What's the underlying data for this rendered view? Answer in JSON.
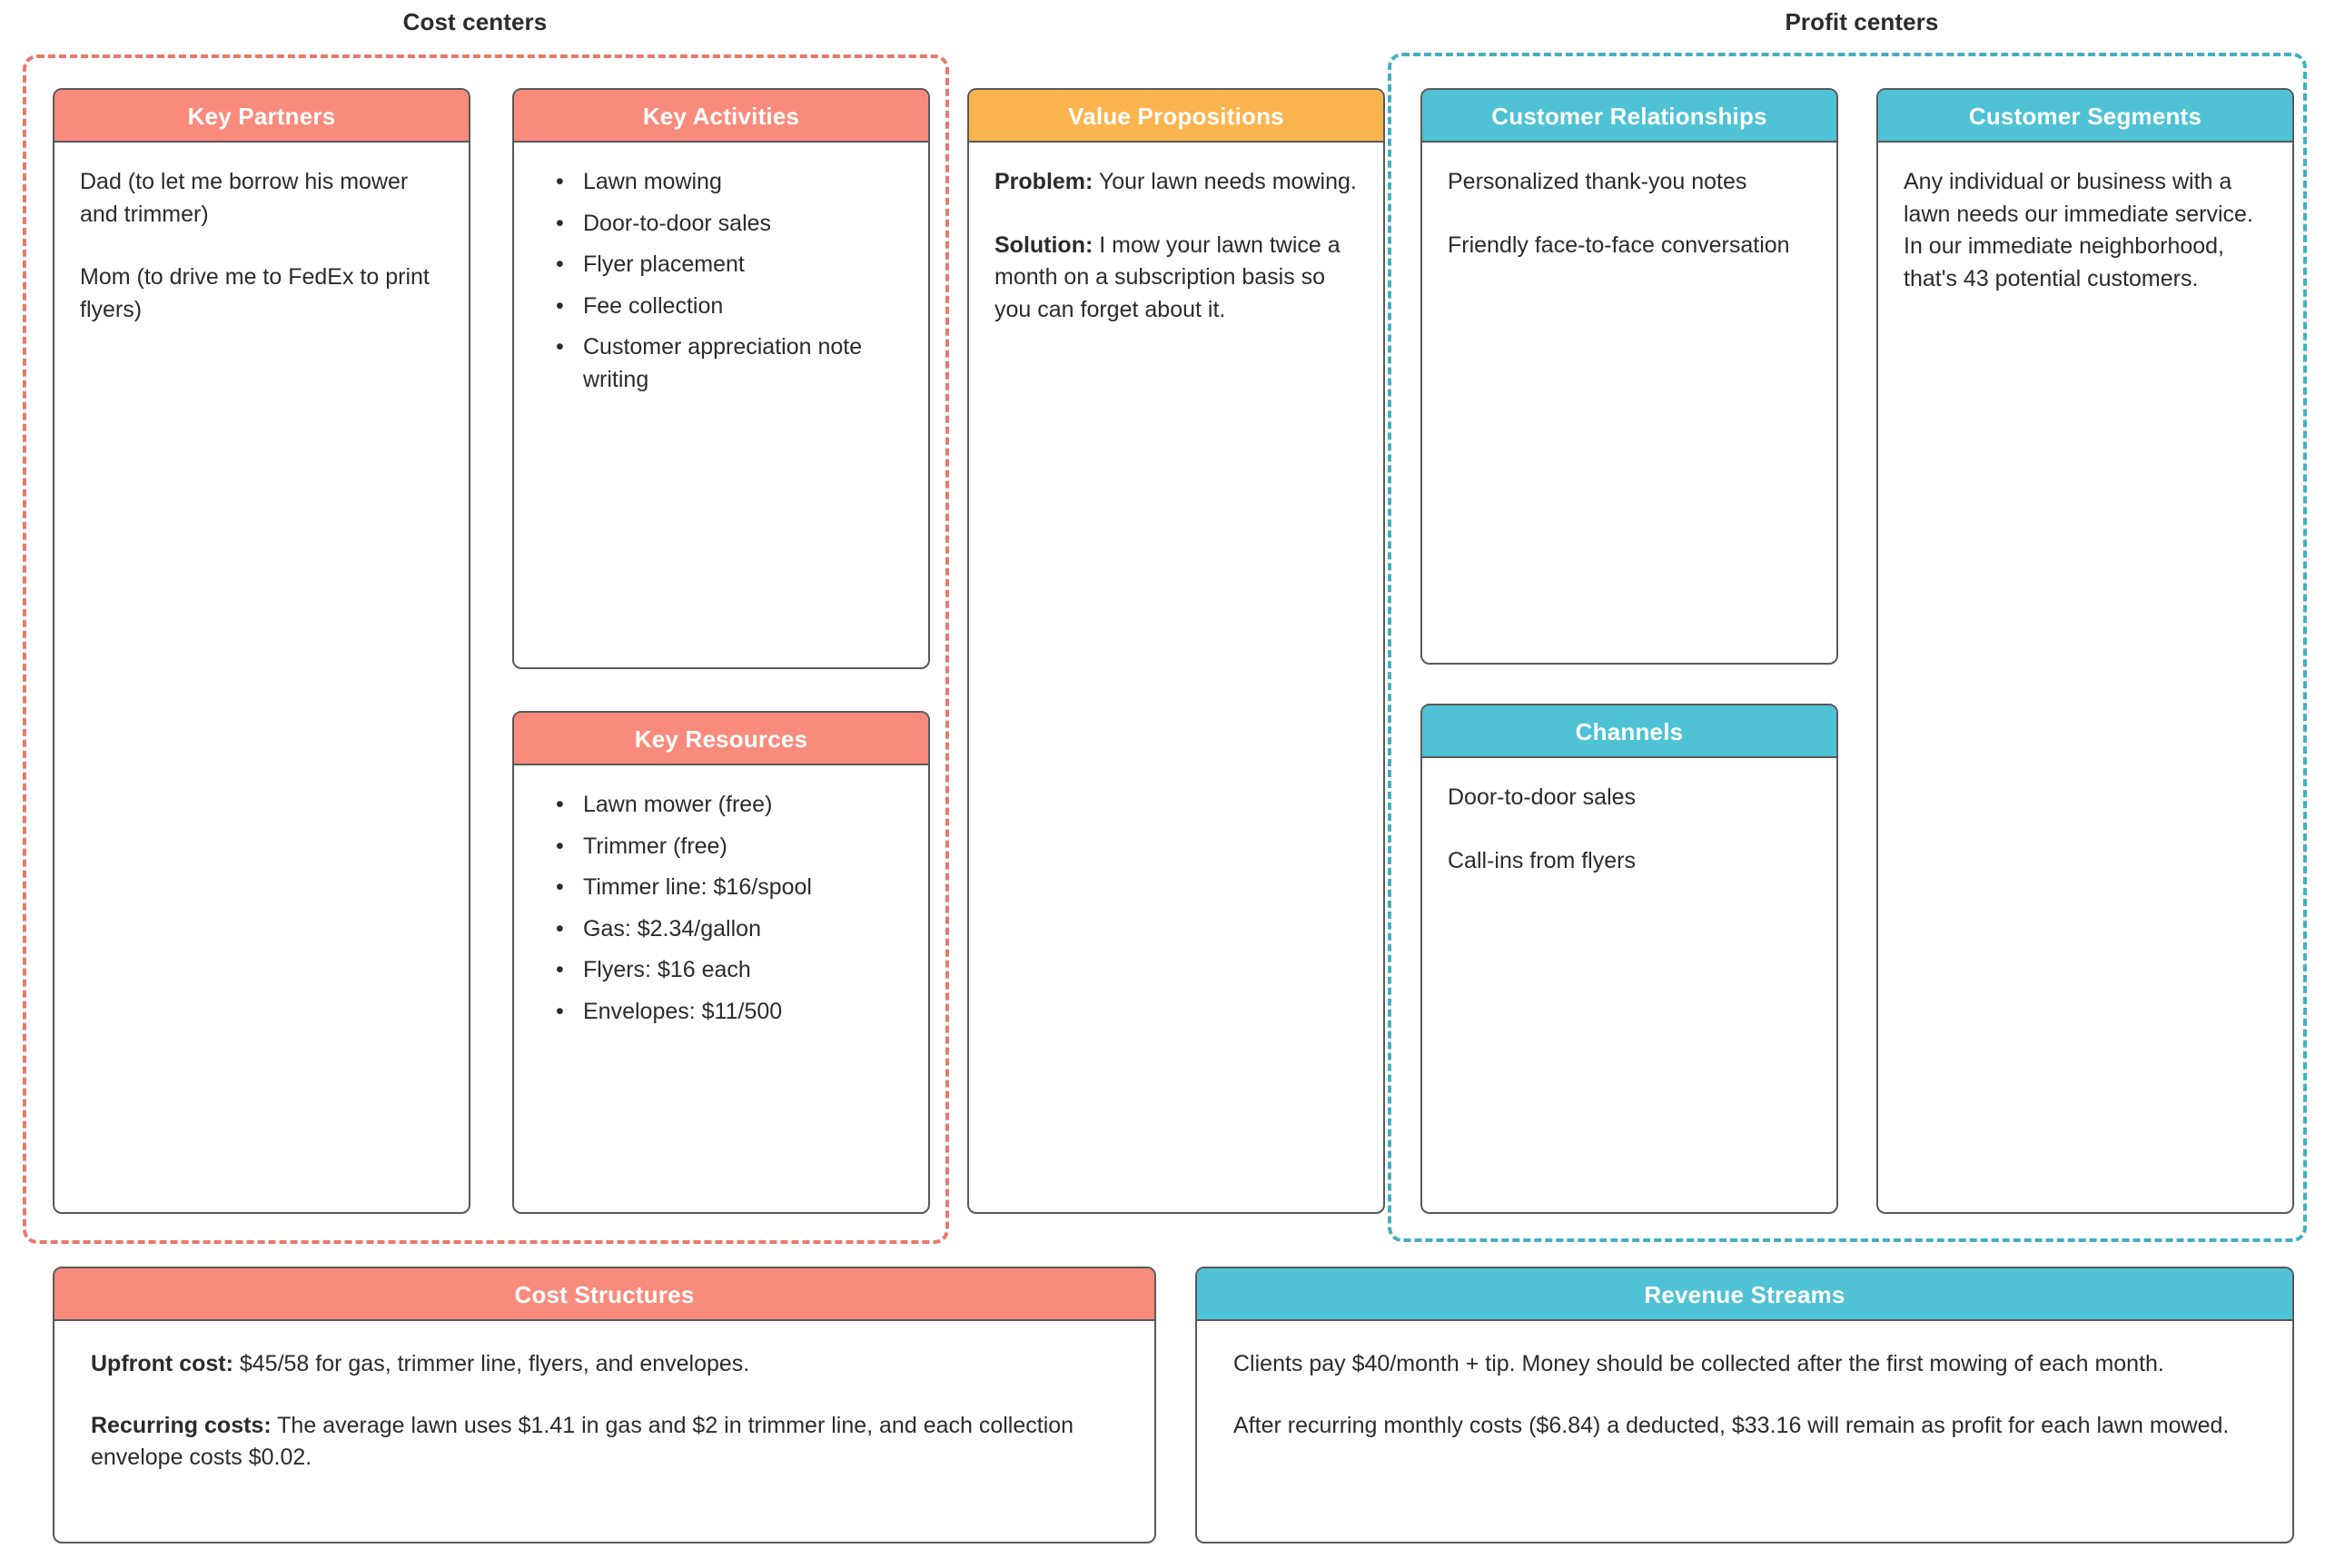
{
  "groups": {
    "cost_centers_label": "Cost centers",
    "profit_centers_label": "Profit centers",
    "cost_border_color": "#E8796B",
    "profit_border_color": "#44AFC1"
  },
  "colors": {
    "red_header": "#F98B7C",
    "teal_header": "#4FC2D5",
    "orange_header": "#FCB44F",
    "panel_border": "#58595B",
    "text": "#2B2B2B"
  },
  "panels": {
    "key_partners": {
      "title": "Key Partners",
      "paragraphs": [
        "Dad (to let me borrow his mower and trimmer)",
        "Mom (to drive me to FedEx to print flyers)"
      ]
    },
    "key_activities": {
      "title": "Key Activities",
      "bullets": [
        "Lawn mowing",
        "Door-to-door sales",
        "Flyer placement",
        "Fee collection",
        "Customer appreciation note writing"
      ]
    },
    "key_resources": {
      "title": "Key Resources",
      "bullets": [
        "Lawn mower (free)",
        "Trimmer (free)",
        "Timmer line: $16/spool",
        "Gas: $2.34/gallon",
        "Flyers: $16 each",
        "Envelopes: $11/500"
      ]
    },
    "value_propositions": {
      "title": "Value Propositions",
      "problem_label": "Problem:",
      "problem_text": " Your lawn needs mowing.",
      "solution_label": "Solution:",
      "solution_text": " I mow your lawn twice a month on a subscription basis so you can forget about it."
    },
    "customer_relationships": {
      "title": "Customer Relationships",
      "paragraphs": [
        "Personalized thank-you notes",
        "Friendly face-to-face conversation"
      ]
    },
    "channels": {
      "title": "Channels",
      "paragraphs": [
        "Door-to-door sales",
        "Call-ins from flyers"
      ]
    },
    "customer_segments": {
      "title": "Customer Segments",
      "paragraphs": [
        "Any individual or business with a lawn needs our immediate service. In our immediate neighborhood, that's 43 potential customers."
      ]
    },
    "cost_structures": {
      "title": "Cost Structures",
      "upfront_label": "Upfront cost:",
      "upfront_text": " $45/58 for gas, trimmer line, flyers, and envelopes.",
      "recurring_label": "Recurring costs:",
      "recurring_text": " The average lawn uses $1.41 in gas and $2 in trimmer line, and each collection envelope costs $0.02."
    },
    "revenue_streams": {
      "title": "Revenue Streams",
      "paragraphs": [
        "Clients pay $40/month + tip. Money should be collected after the first mowing of each month.",
        "After recurring monthly costs ($6.84) a deducted, $33.16 will remain as profit for each lawn mowed."
      ]
    }
  }
}
